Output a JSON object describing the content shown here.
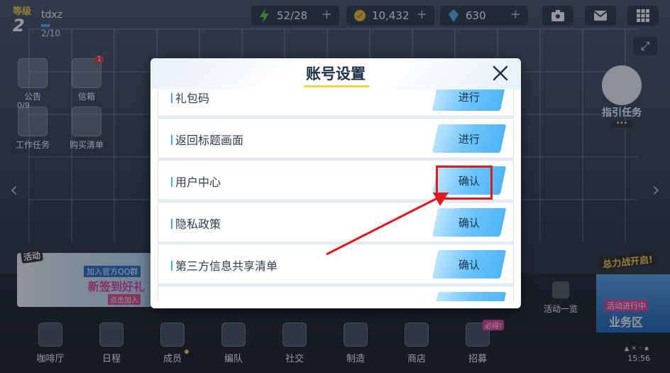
{
  "player": {
    "level_label": "等级",
    "level": "2",
    "name": "tdxz",
    "exp": "2/10",
    "exp_fill": 0.2
  },
  "resources": [
    {
      "name": "stamina",
      "value": "52/28",
      "icon": "lightning-icon",
      "color": "#5fd13a"
    },
    {
      "name": "gold",
      "value": "10,432",
      "icon": "coin-icon",
      "color": "#f2c230"
    },
    {
      "name": "gem",
      "value": "630",
      "icon": "crystal-icon",
      "color": "#4fb4f6"
    }
  ],
  "left_icons": [
    {
      "label": "公告",
      "icon": "megaphone-icon"
    },
    {
      "label": "信箱",
      "icon": "mail-icon",
      "badge": "1"
    },
    {
      "label": "工作任务",
      "icon": "checklist-icon",
      "count": "0/9"
    },
    {
      "label": "购买清单",
      "icon": "shopping-bag-icon"
    }
  ],
  "event_banner": {
    "tag": "活动",
    "line1": "加入官方QQ群",
    "line2": "新签到好礼",
    "line3": "点击加入"
  },
  "guide": {
    "label": "指引任务",
    "dots": "•••"
  },
  "right_banner": {
    "tag": "总力战开启!",
    "status": "活动进行中",
    "name": "业务区"
  },
  "lock_item": {
    "label": "活动一览"
  },
  "bottom_nav": [
    {
      "label": "咖啡厅",
      "icon": "coffee-icon"
    },
    {
      "label": "日程",
      "icon": "schedule-icon"
    },
    {
      "label": "成员",
      "icon": "members-icon"
    },
    {
      "label": "编队",
      "icon": "formation-icon"
    },
    {
      "label": "社交",
      "icon": "social-icon"
    },
    {
      "label": "制造",
      "icon": "craft-icon"
    },
    {
      "label": "商店",
      "icon": "shop-icon"
    },
    {
      "label": "招募",
      "icon": "recruit-icon",
      "badge": "必得!"
    }
  ],
  "status": {
    "time": "15:56",
    "signal": "▲ ✕ ◦ ▪"
  },
  "modal": {
    "title": "账号设置",
    "rows": [
      {
        "label": "礼包码",
        "button": "进行"
      },
      {
        "label": "返回标题画面",
        "button": "进行"
      },
      {
        "label": "用户中心",
        "button": "确认"
      },
      {
        "label": "隐私政策",
        "button": "确认"
      },
      {
        "label": "第三方信息共享清单",
        "button": "确认"
      }
    ]
  },
  "annotation": {
    "color": "#e0191e"
  }
}
